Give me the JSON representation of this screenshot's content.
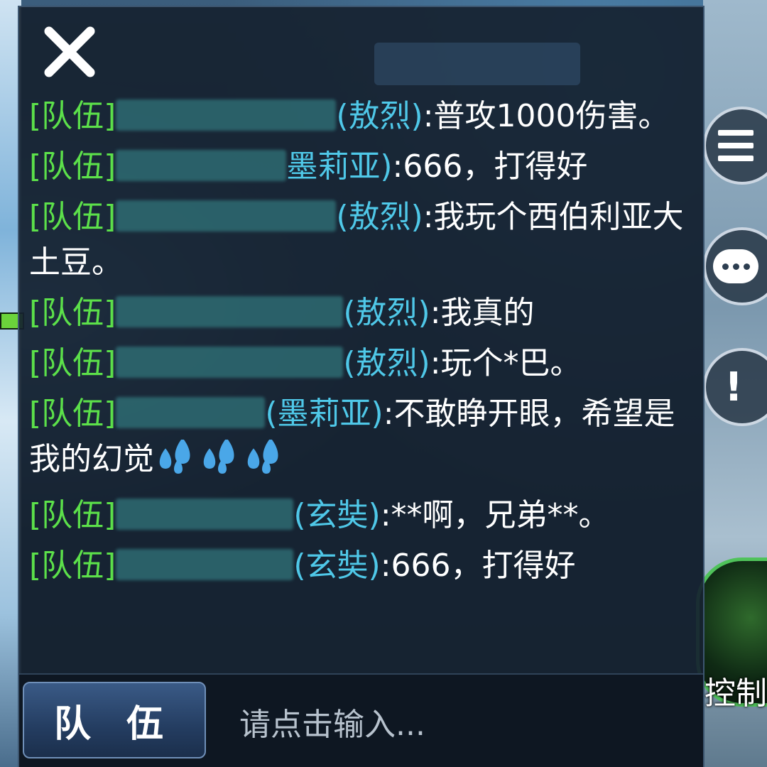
{
  "chat": {
    "messages": [
      {
        "tag": "[队伍]",
        "hero": "(敖烈)",
        "text": ":普攻1000伤害。",
        "name_width": 310
      },
      {
        "tag": "[队伍]",
        "hero": "墨莉亚)",
        "text": ":666，打得好",
        "name_width": 240
      },
      {
        "tag": "[队伍]",
        "hero": "(敖烈)",
        "text": ":我玩个西伯利亚大土豆。",
        "name_width": 310
      },
      {
        "tag": "[队伍]",
        "hero": "(敖烈)",
        "text": ":我真的",
        "name_width": 320
      },
      {
        "tag": "[队伍]",
        "hero": "(敖烈)",
        "text": ":玩个*巴。",
        "name_width": 320
      },
      {
        "tag": "[队伍]",
        "hero": "(墨莉亚)",
        "text": ":不敢睁开眼，希望是我的幻觉",
        "name_width": 210,
        "emoji": "sweat-drops-icon",
        "emoji_count": 3
      },
      {
        "tag": "[队伍]",
        "hero": "(玄奘)",
        "text": ":**啊，兄弟**。",
        "name_width": 250
      },
      {
        "tag": "[队伍]",
        "hero": "(玄奘)",
        "text": ":666，打得好",
        "name_width": 250
      }
    ]
  },
  "input_bar": {
    "channel_label": "队 伍",
    "placeholder": "请点击输入..."
  },
  "side": {
    "skill_label": "控制"
  },
  "icons": {
    "close": "close-icon",
    "menu": "list-menu-icon",
    "chat": "chat-bubble-icon",
    "alert": "exclamation-icon"
  },
  "colors": {
    "team_tag": "#5ce04a",
    "hero_name": "#4fc8e8",
    "message_text": "#ffffff",
    "panel_bg": "#16222f"
  }
}
